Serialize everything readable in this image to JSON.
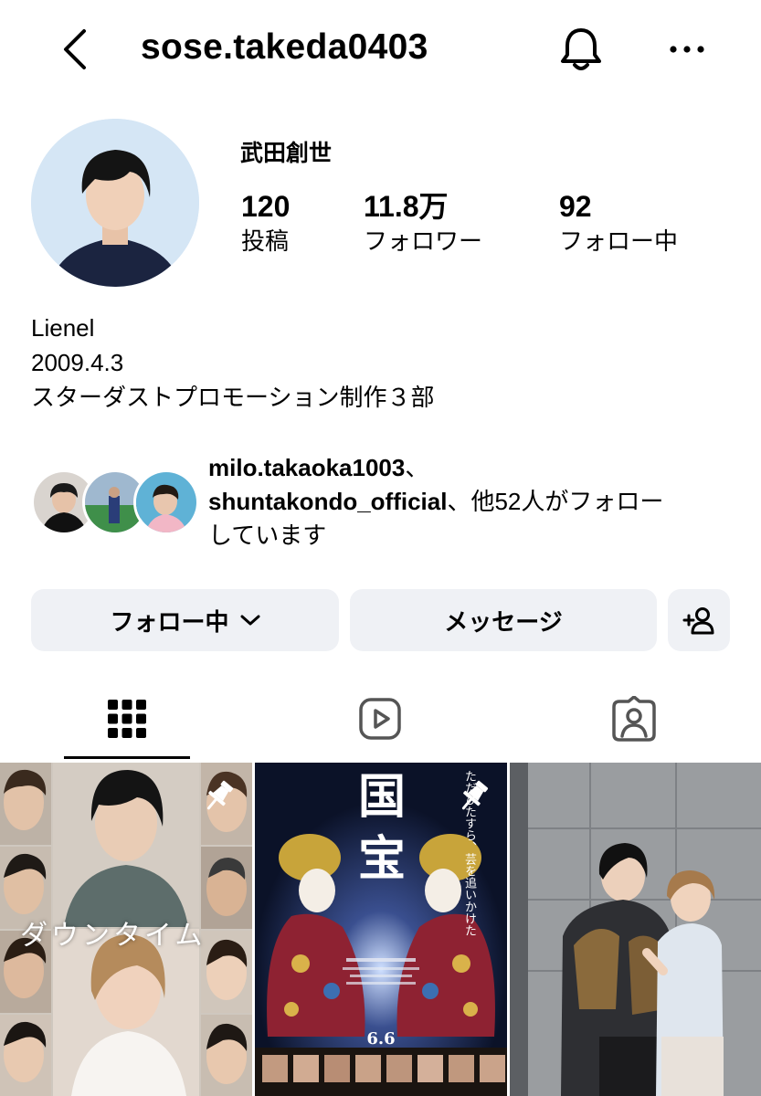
{
  "header": {
    "username": "sose.takeda0403",
    "back_icon": "chevron-left-icon",
    "bell_icon": "bell-icon",
    "more_icon": "more-horizontal-icon"
  },
  "profile": {
    "display_name": "武田創世",
    "stats": {
      "posts_count": "120",
      "posts_label": "投稿",
      "followers_count": "11.8万",
      "followers_label": "フォロワー",
      "following_count": "92",
      "following_label": "フォロー中"
    },
    "bio": {
      "line1": "Lienel",
      "line2": "2009.4.3",
      "line3": "スターダストプロモーション制作３部"
    }
  },
  "followed_by": {
    "user1": "milo.takaoka1003",
    "separator1": "、",
    "user2": "shuntakondo_official",
    "suffix": "、他52人がフォロー",
    "line3": "しています"
  },
  "actions": {
    "follow_label": "フォロー中",
    "message_label": "メッセージ",
    "add_user_icon": "add-user-icon"
  },
  "tabs": [
    {
      "icon": "grid-icon",
      "active": true
    },
    {
      "icon": "reels-icon",
      "active": false
    },
    {
      "icon": "tagged-icon",
      "active": false
    }
  ],
  "posts": {
    "post1_caption": "ダウンタイム",
    "post2_title": "国宝",
    "post2_date": "6.6",
    "post2_tagline": "ただひたすら、芸を追いかけた"
  },
  "colors": {
    "button_bg": "#eff1f5",
    "text": "#000000",
    "background": "#ffffff"
  }
}
